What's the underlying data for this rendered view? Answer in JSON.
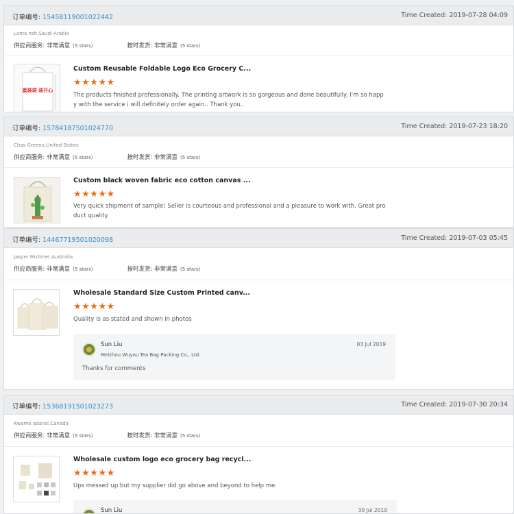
{
  "colors": {
    "link": "#2f8fd1",
    "star": "#f06a0f",
    "header_bg": "#ebeced"
  },
  "labels": {
    "order_prefix": "订单编号:",
    "supplier_service": "供应商服务:",
    "on_time_shipping": "按时发货:",
    "very_satisfied": "非常满意",
    "five_stars": "(5 stars)"
  },
  "orders": [
    {
      "number": "15458119001022442",
      "time": "Time Created: 2019-07-28 04:09",
      "buyer": "Lama hsh,Saudi Arabia",
      "product_title": "Custom Reusable Foldable Logo Eco Grocery C...",
      "product_image_text": "套装袋 装开心",
      "stars": "★★★★★",
      "rating": 5,
      "review_lines": [
        "The products finished professionally. The printing artwork is so gorgeous and done beautifully. I'm so happ",
        "y with the service i will definitely order again.. Thank you.."
      ]
    },
    {
      "number": "15784187501024770",
      "time": "Time Created: 2019-07-23 18:20",
      "buyer": "Chas Greeno,United States",
      "product_title": "Custom black woven fabric eco cotton canvas ...",
      "stars": "★★★★★",
      "rating": 5,
      "review_lines": [
        "Very quick shipment of sample! Seller is courteous and professional and a pleasure to work with. Great pro",
        "duct quality."
      ]
    },
    {
      "number": "14467719501020098",
      "time": "Time Created: 2019-07-03 05:45",
      "buyer": "Jasper Mutimer,Australia",
      "product_title": "Wholesale Standard Size Custom Printed canv...",
      "stars": "★★★★★",
      "rating": 5,
      "review_lines": [
        "Quality is as stated and shown in photos"
      ],
      "reply": {
        "name": "Sun Liu",
        "company": "Meizhou Wuyou Tea Bag Packing Co., Ltd.",
        "date": "03 Jul 2019",
        "text": "Thanks for comments"
      }
    },
    {
      "number": "15368191501023273",
      "time": "Time Created: 2019-07-30 20:34",
      "buyer": "Kwame adansi,Canada",
      "product_title": "Wholesale custom logo eco grocery bag recycl...",
      "stars": "★★★★★",
      "rating": 5,
      "review_lines": [
        "Ups messed up but my supplier did go above and beyond to help me."
      ],
      "reply": {
        "name": "Sun Liu",
        "date": "30 Jul 2019"
      }
    }
  ]
}
